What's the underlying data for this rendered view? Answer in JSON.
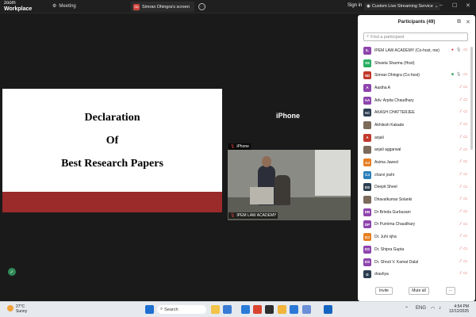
{
  "topbar": {
    "logo_line1": "zoom",
    "logo_line2": "Workplace",
    "meeting_label": "Meeting",
    "tab_avatar": "SD",
    "tab_label": "Simran Dhingra's screen",
    "sign_in": "Sign in",
    "stream_label": "Custom Live Streaming Service"
  },
  "stage": {
    "slide_line1": "Declaration",
    "slide_line2": "Of",
    "slide_line3": "Best Research Papers",
    "slide_band_color": "#9b2a2a",
    "iphone_label": "iPhone",
    "iphone_tag": "iPhone",
    "video_tag": "IPEM LAW ACADEMY"
  },
  "participants": {
    "title": "Participants (49)",
    "search_placeholder": "Find a participant",
    "invite_label": "Invite",
    "mute_all_label": "Mute all",
    "more_label": "···",
    "items": [
      {
        "initials": "IL",
        "color": "#8e44ad",
        "name": "IPEM LAW ACADEMY (Co-host, me)",
        "mic": "recording"
      },
      {
        "initials": "SS",
        "color": "#27ae60",
        "name": "Shweta Sharma (Host)",
        "mic": "none"
      },
      {
        "initials": "SD",
        "color": "#c0392b",
        "name": "Simran Dhingra (Co-host)",
        "mic": "share"
      },
      {
        "initials": "A",
        "color": "#8e44ad",
        "name": "Aastha A",
        "mic": "muted"
      },
      {
        "initials": "AA",
        "color": "#8e44ad",
        "name": "Adv. Arpita Chaudhary",
        "mic": "muted"
      },
      {
        "initials": "AC",
        "color": "#2c3e50",
        "name": "AKASH CHATTERJEE",
        "mic": "muted"
      },
      {
        "initials": "",
        "color": "#7c6a5a",
        "name": "Akhilesh Kakade",
        "mic": "muted"
      },
      {
        "initials": "A",
        "color": "#c0392b",
        "name": "anjali",
        "mic": "muted"
      },
      {
        "initials": "",
        "color": "#7c6a5a",
        "name": "anjali aggarwal",
        "mic": "muted"
      },
      {
        "initials": "AJ",
        "color": "#e67e22",
        "name": "Asima Jawed",
        "mic": "muted"
      },
      {
        "initials": "CJ",
        "color": "#2980b9",
        "name": "charvi joshi",
        "mic": "muted"
      },
      {
        "initials": "DS",
        "color": "#2c3e50",
        "name": "Deepit Sheel",
        "mic": "muted"
      },
      {
        "initials": "",
        "color": "#7c6a5a",
        "name": "Dhavalkumar Solanki",
        "mic": "muted"
      },
      {
        "initials": "DB",
        "color": "#8e44ad",
        "name": "Dr Brinda Gurbuxani",
        "mic": "muted"
      },
      {
        "initials": "DP",
        "color": "#8e44ad",
        "name": "Dr Purnima Chaudhary",
        "mic": "muted"
      },
      {
        "initials": "DJ",
        "color": "#e67e22",
        "name": "Dr. Juhi ojha",
        "mic": "muted"
      },
      {
        "initials": "DS",
        "color": "#8e44ad",
        "name": "Dr. Shipra Gupta",
        "mic": "muted"
      },
      {
        "initials": "DS",
        "color": "#8e44ad",
        "name": "Dr. Shruti V. Kamat Dalal",
        "mic": "muted"
      },
      {
        "initials": "D",
        "color": "#2c3e50",
        "name": "drashya",
        "mic": "muted"
      }
    ]
  },
  "taskbar": {
    "temperature": "27°C",
    "weather": "Sunny",
    "search_label": "Search",
    "time": "4:54 PM",
    "date": "12/12/2025"
  }
}
